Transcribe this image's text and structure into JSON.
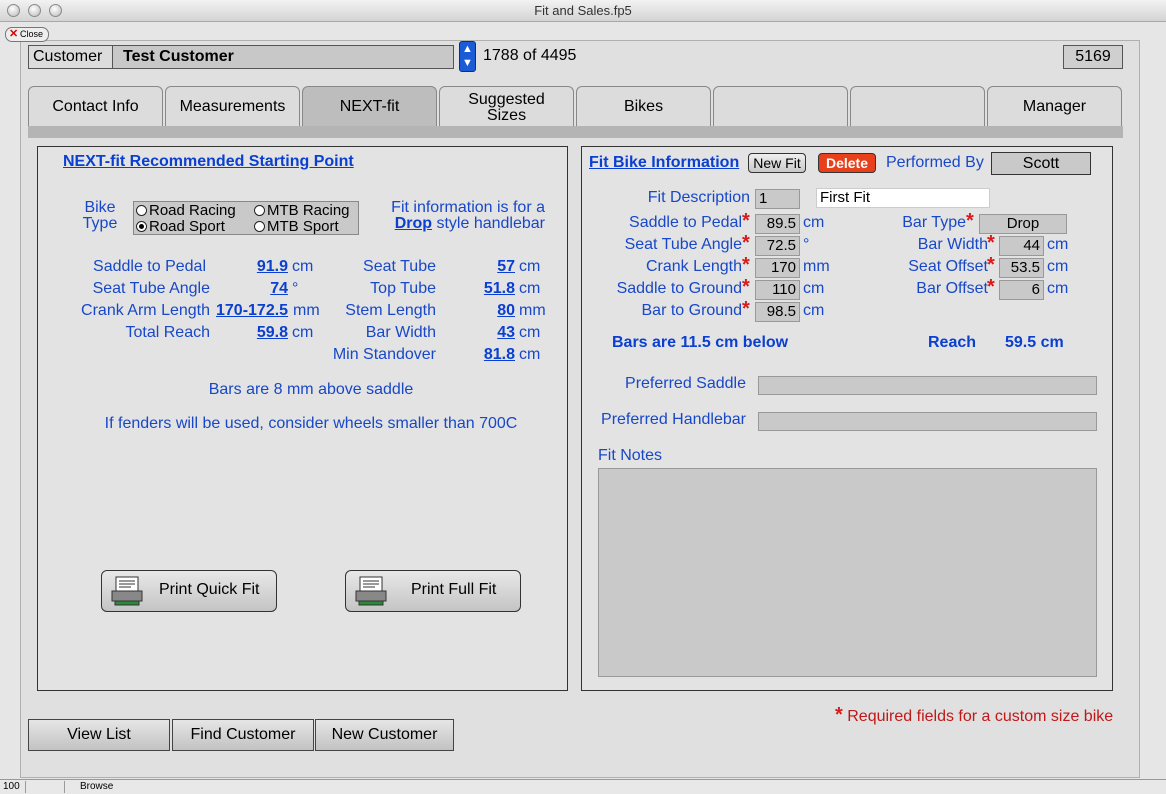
{
  "window": {
    "title": "Fit and Sales.fp5",
    "close_label": "Close"
  },
  "header": {
    "customer_label": "Customer",
    "customer_name": "Test Customer",
    "record_count": "1788 of 4495",
    "record_id": "5169"
  },
  "tabs": [
    {
      "label": "Contact Info"
    },
    {
      "label": "Measurements"
    },
    {
      "label": "NEXT-fit"
    },
    {
      "label": "Suggested Sizes"
    },
    {
      "label": "Bikes"
    },
    {
      "label": ""
    },
    {
      "label": ""
    },
    {
      "label": "Manager"
    }
  ],
  "left": {
    "title": "NEXT-fit Recommended Starting Point",
    "bike_type_label1": "Bike",
    "bike_type_label2": "Type",
    "bike_types": [
      {
        "label": "Road Racing",
        "selected": false
      },
      {
        "label": "MTB Racing",
        "selected": false
      },
      {
        "label": "Road Sport",
        "selected": true
      },
      {
        "label": "MTB Sport",
        "selected": false
      }
    ],
    "fit_info_line1": "Fit information is for a",
    "fit_info_drop": "Drop",
    "fit_info_line2": "style handlebar",
    "measures_left": [
      {
        "label": "Saddle to Pedal",
        "value": "91.9",
        "unit": "cm"
      },
      {
        "label": "Seat Tube Angle",
        "value": "74",
        "unit": "°"
      },
      {
        "label": "Crank Arm Length",
        "value": "170-172.5",
        "unit": "mm"
      },
      {
        "label": "Total Reach",
        "value": "59.8",
        "unit": "cm"
      }
    ],
    "measures_right": [
      {
        "label": "Seat Tube",
        "value": "57",
        "unit": "cm"
      },
      {
        "label": "Top Tube",
        "value": "51.8",
        "unit": "cm"
      },
      {
        "label": "Stem Length",
        "value": "80",
        "unit": "mm"
      },
      {
        "label": "Bar Width",
        "value": "43",
        "unit": "cm"
      },
      {
        "label": "Min Standover",
        "value": "81.8",
        "unit": "cm"
      }
    ],
    "bars_note": "Bars are 8 mm above saddle",
    "fender_note": "If fenders will be used, consider wheels smaller than 700C",
    "print_quick": "Print Quick Fit",
    "print_full": "Print Full Fit"
  },
  "right": {
    "title": "Fit Bike Information",
    "new_fit": "New Fit",
    "delete": "Delete",
    "performed_by_label": "Performed By",
    "performed_by": "Scott",
    "fit_desc_label": "Fit Description",
    "fit_desc_num": "1",
    "fit_desc_text": "First Fit",
    "fields_left": [
      {
        "label": "Saddle to Pedal",
        "value": "89.5",
        "unit": "cm"
      },
      {
        "label": "Seat Tube Angle",
        "value": "72.5",
        "unit": "°"
      },
      {
        "label": "Crank Length",
        "value": "170",
        "unit": "mm"
      },
      {
        "label": "Saddle to Ground",
        "value": "110",
        "unit": "cm"
      },
      {
        "label": "Bar to Ground",
        "value": "98.5",
        "unit": "cm"
      }
    ],
    "fields_right": [
      {
        "label": "Bar Type",
        "value": "Drop",
        "unit": ""
      },
      {
        "label": "Bar Width",
        "value": "44",
        "unit": "cm"
      },
      {
        "label": "Seat Offset",
        "value": "53.5",
        "unit": "cm"
      },
      {
        "label": "Bar Offset",
        "value": "6",
        "unit": "cm"
      }
    ],
    "bars_below": "Bars are 11.5 cm below",
    "reach_label": "Reach",
    "reach_value": "59.5 cm",
    "preferred_saddle_label": "Preferred Saddle",
    "preferred_saddle": "",
    "preferred_handlebar_label": "Preferred Handlebar",
    "preferred_handlebar": "",
    "fit_notes_label": "Fit Notes",
    "fit_notes": ""
  },
  "required_note": "Required fields for a custom size bike",
  "bottom_buttons": {
    "view_list": "View List",
    "find_customer": "Find Customer",
    "new_customer": "New Customer"
  },
  "status": {
    "zoom": "100",
    "mode": "Browse"
  }
}
